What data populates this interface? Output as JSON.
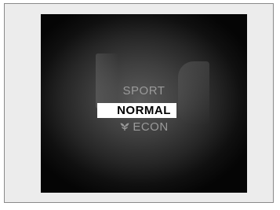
{
  "display": {
    "modes": {
      "sport": "SPORT",
      "normal": "NORMAL",
      "econ": "ECON"
    },
    "selected": "NORMAL",
    "colors": {
      "selected_bg": "#ffffff",
      "selected_text": "#000000",
      "inactive_text": "#9a9a9a"
    },
    "icons": {
      "econ": "econ-leaf-icon"
    }
  }
}
